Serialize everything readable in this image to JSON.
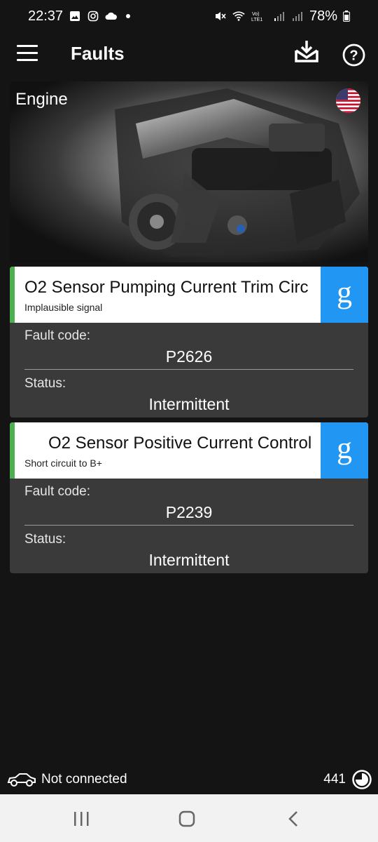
{
  "status_bar": {
    "time": "22:37",
    "battery": "78%",
    "icons_left": [
      "gallery-icon",
      "instagram-icon",
      "cloud-icon",
      "dot-icon"
    ],
    "icons_right": [
      "mute-icon",
      "wifi-icon",
      "volte-icon",
      "signal-icon",
      "signal-icon",
      "battery-icon"
    ]
  },
  "app_bar": {
    "title": "Faults",
    "icons": [
      "menu-icon",
      "download-icon",
      "help-icon"
    ]
  },
  "banner": {
    "title": "Engine",
    "flag": "us-flag-icon"
  },
  "faults": [
    {
      "title": "O2 Sensor Pumping Current Trim Circ",
      "subtitle": "Implausible signal",
      "code_label": "Fault code:",
      "code": "P2626",
      "status_label": "Status:",
      "status": "Intermittent",
      "search_icon": "g"
    },
    {
      "title": "O2 Sensor Positive Current Control",
      "subtitle": "Short circuit to B+",
      "code_label": "Fault code:",
      "code": "P2239",
      "status_label": "Status:",
      "status": "Intermittent",
      "search_icon": "g"
    }
  ],
  "footer": {
    "connection": "Not connected",
    "count": "441"
  },
  "colors": {
    "background": "#141414",
    "card": "#3a3a3a",
    "accent_green": "#4caf50",
    "google_blue": "#2196f3"
  }
}
